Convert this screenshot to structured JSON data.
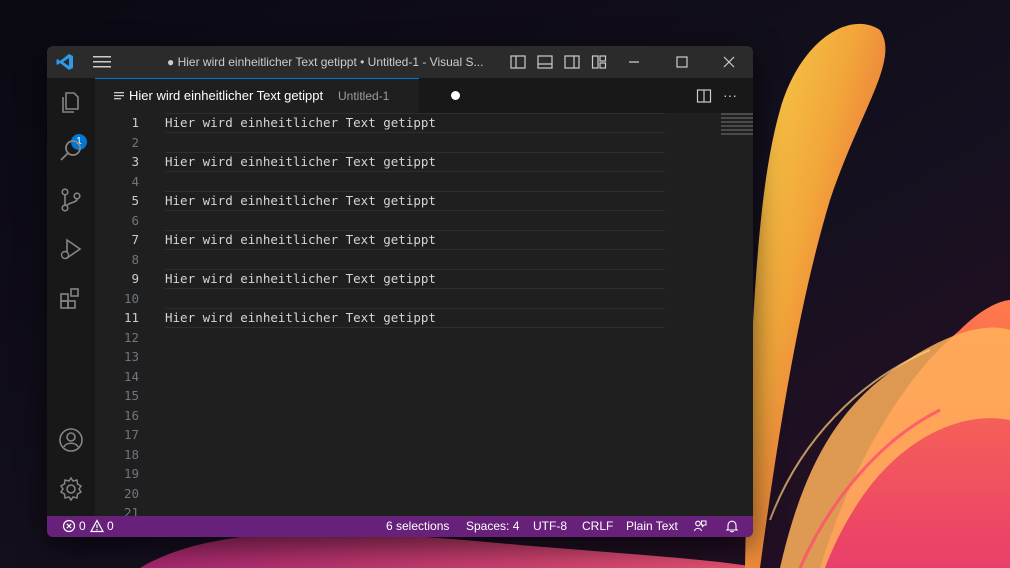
{
  "window": {
    "title": "● Hier wird einheitlicher Text getippt • Untitled-1 - Visual S..."
  },
  "activity_bar": {
    "explorer_badge": "1",
    "items": [
      "explorer",
      "search",
      "source-control",
      "run-and-debug",
      "extensions"
    ],
    "bottom_items": [
      "accounts",
      "manage"
    ]
  },
  "tab": {
    "label": "Hier wird einheitlicher Text getippt",
    "description": "Untitled-1",
    "more": "···"
  },
  "editor": {
    "line_numbers": [
      "1",
      "2",
      "3",
      "4",
      "5",
      "6",
      "7",
      "8",
      "9",
      "10",
      "11",
      "12",
      "13",
      "14",
      "15",
      "16",
      "17",
      "18",
      "19",
      "20",
      "21"
    ],
    "lines": {
      "l1": "Hier wird einheitlicher Text getippt",
      "l3": "Hier wird einheitlicher Text getippt",
      "l5": "Hier wird einheitlicher Text getippt",
      "l7": "Hier wird einheitlicher Text getippt",
      "l9": "Hier wird einheitlicher Text getippt",
      "l11": "Hier wird einheitlicher Text getippt"
    }
  },
  "statusbar": {
    "errors": "0",
    "warnings": "0",
    "selections": "6 selections",
    "spaces": "Spaces: 4",
    "encoding": "UTF-8",
    "eol": "CRLF",
    "language": "Plain Text"
  },
  "colors": {
    "statusbar_bg": "#68217a",
    "accent": "#0078d4",
    "editor_bg": "#1f1f1f"
  }
}
